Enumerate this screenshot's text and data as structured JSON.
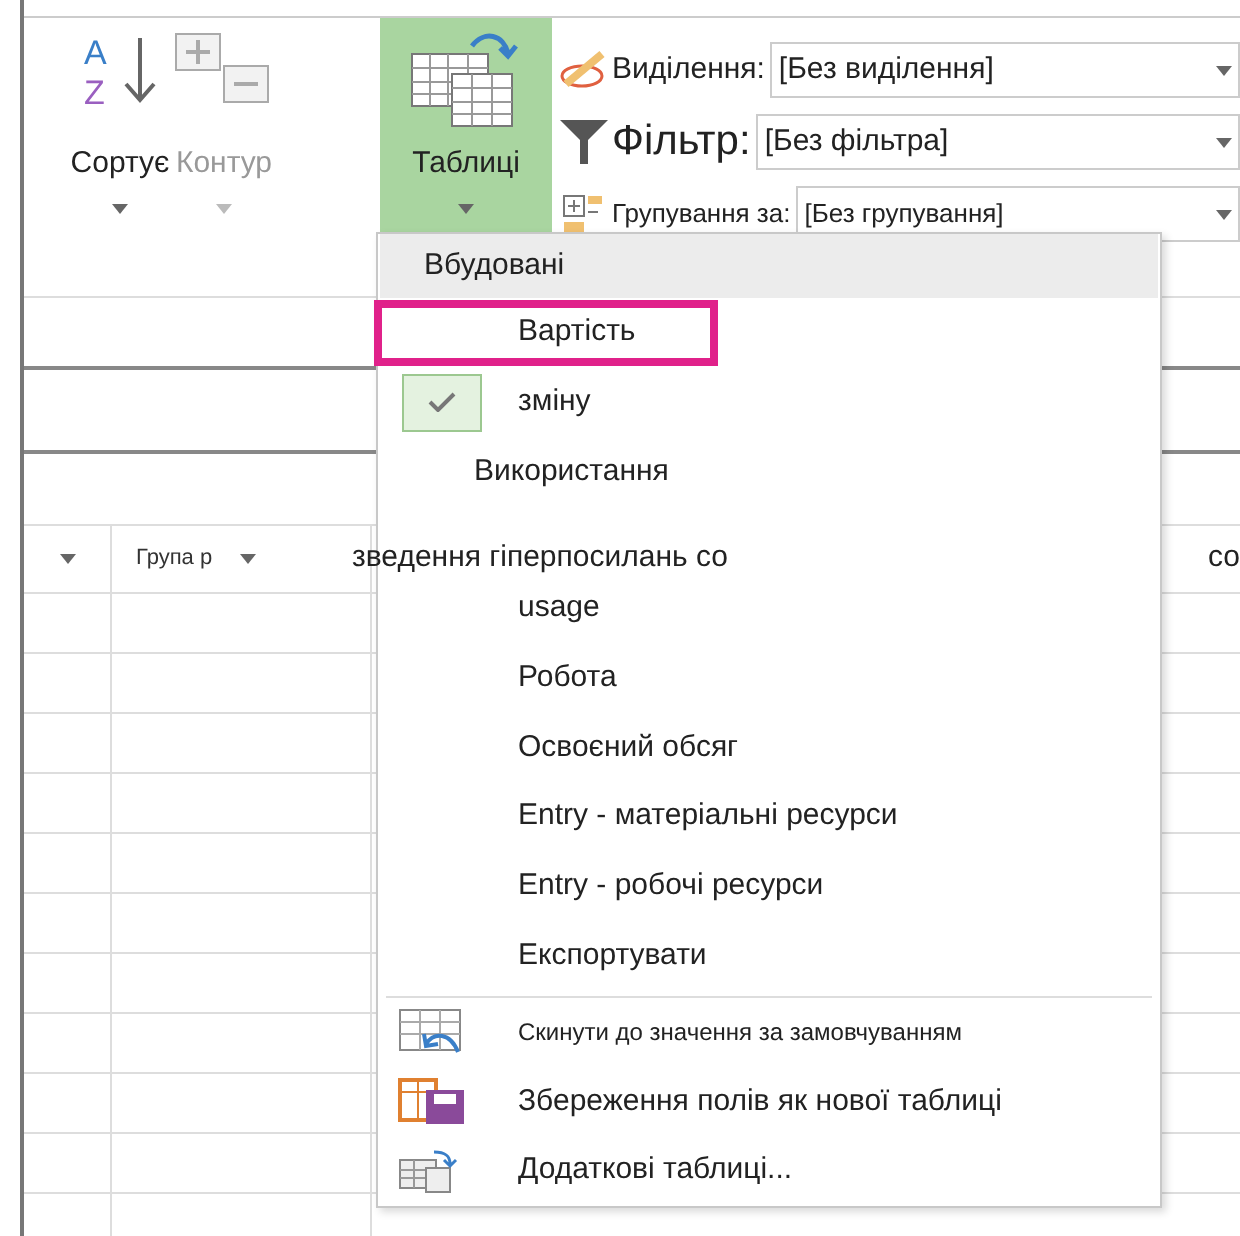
{
  "ribbon": {
    "buttons": [
      {
        "kind": "sort",
        "label": "Сортує",
        "icon_letters": [
          "A",
          "Z"
        ],
        "selected": false,
        "disabled": false
      },
      {
        "kind": "outline",
        "label": "Контур",
        "selected": false,
        "disabled": true
      },
      {
        "kind": "tables",
        "label": "Таблиці",
        "selected": true,
        "disabled": false
      }
    ],
    "selectors": [
      {
        "kind": "highlight",
        "label": "Виділення:",
        "value": "[Без виділення]"
      },
      {
        "kind": "filter",
        "label": "Фільтр:",
        "value": "[Без фільтра]"
      },
      {
        "kind": "group",
        "label": "Групування за:",
        "value": "[Без групування]"
      }
    ]
  },
  "table": {
    "columns": [
      {
        "label": "Група р"
      },
      {
        "label": "зведення гіперпосилань со"
      },
      {
        "label": "со"
      }
    ]
  },
  "menu": {
    "header": "Вбудовані",
    "items": [
      {
        "label": "Вартість",
        "checked": false,
        "highlighted": true
      },
      {
        "label": "зміну",
        "checked": true,
        "highlighted": false
      },
      {
        "label": "Використання",
        "checked": false,
        "highlighted": false
      },
      {
        "label": "usage",
        "checked": false,
        "highlighted": false
      },
      {
        "label": "Робота",
        "checked": false,
        "highlighted": false
      },
      {
        "label": "Освоєний обсяг",
        "checked": false,
        "highlighted": false
      },
      {
        "label": "Entry - матеріальні ресурси",
        "checked": false,
        "highlighted": false
      },
      {
        "label": "Entry - робочі ресурси",
        "checked": false,
        "highlighted": false
      },
      {
        "label": "Експортувати",
        "checked": false,
        "highlighted": false
      }
    ],
    "actions": [
      {
        "kind": "reset",
        "label": "Скинути до значення за замовчуванням"
      },
      {
        "kind": "save",
        "label": "Збереження полів як нової таблиці"
      },
      {
        "kind": "more",
        "label": "Додаткові таблиці..."
      }
    ]
  }
}
